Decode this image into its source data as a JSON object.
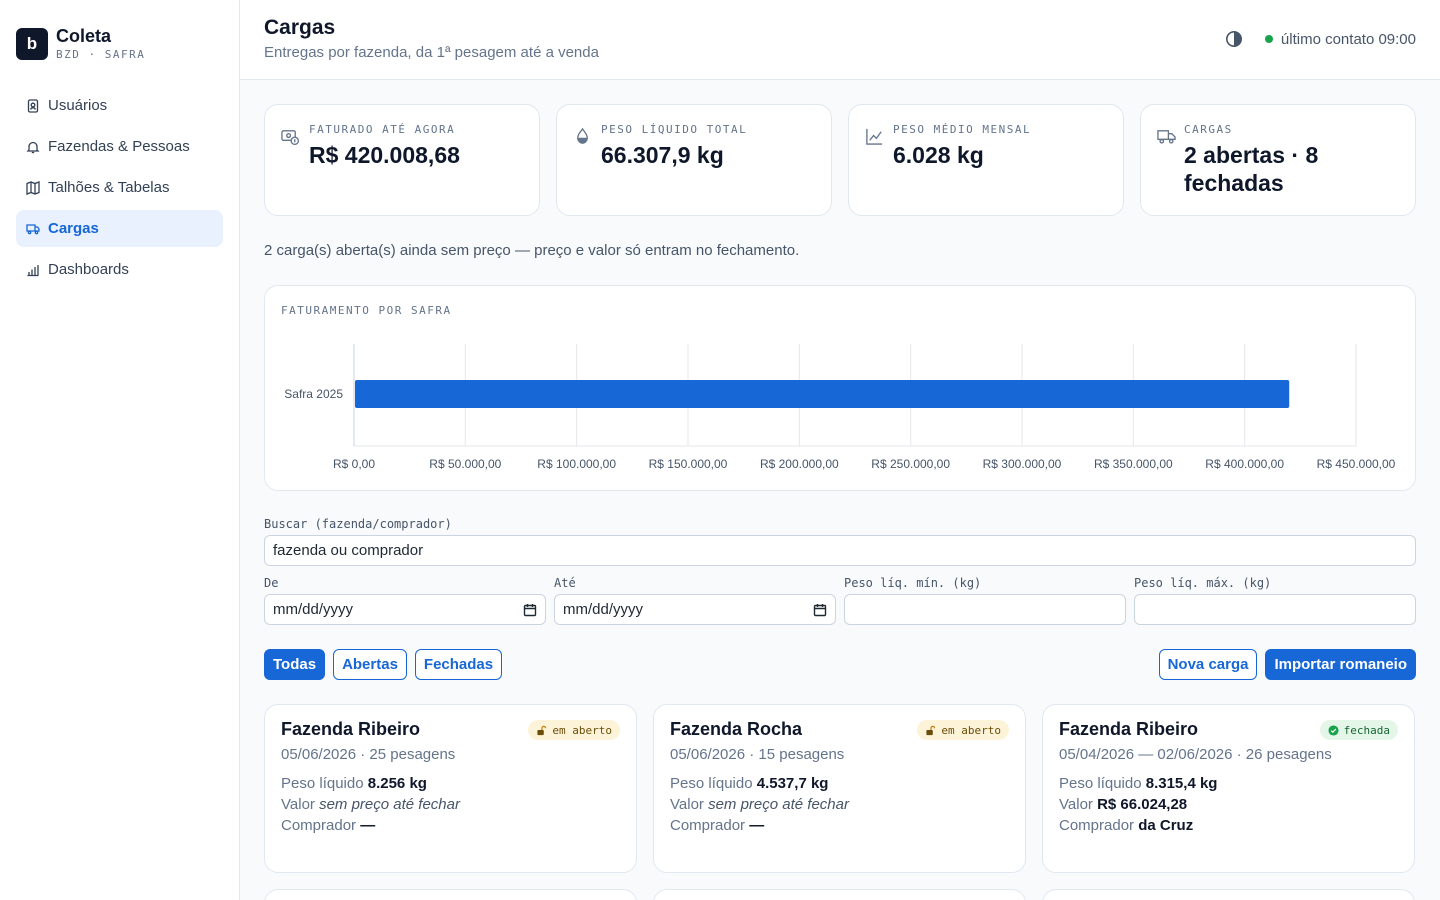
{
  "brand": {
    "logo_letter": "b",
    "name": "Coleta",
    "subtitle": "BZD · SAFRA"
  },
  "sidebar": {
    "items": [
      {
        "label": "Usuários",
        "icon": "id-badge-icon",
        "active": false
      },
      {
        "label": "Fazendas & Pessoas",
        "icon": "bell-icon",
        "active": false
      },
      {
        "label": "Talhões & Tabelas",
        "icon": "map-icon",
        "active": false
      },
      {
        "label": "Cargas",
        "icon": "truck-icon",
        "active": true
      },
      {
        "label": "Dashboards",
        "icon": "bar-chart-icon",
        "active": false
      }
    ]
  },
  "header": {
    "title": "Cargas",
    "subtitle": "Entregas por fazenda, da 1ª pesagem até a venda",
    "status": "último contato 09:00",
    "status_color": "#16a34a"
  },
  "kpis": [
    {
      "label": "FATURADO ATÉ AGORA",
      "value": "R$ 420.008,68",
      "icon": "money-icon"
    },
    {
      "label": "PESO LÍQUIDO TOTAL",
      "value": "66.307,9 kg",
      "icon": "droplet-icon"
    },
    {
      "label": "PESO MÉDIO MENSAL",
      "value": "6.028 kg",
      "icon": "trend-icon"
    },
    {
      "label": "CARGAS",
      "value": "2 abertas · 8 fechadas",
      "icon": "truck-icon"
    }
  ],
  "notice": "2 carga(s) aberta(s) ainda sem preço — preço e valor só entram no fechamento.",
  "chart_data": {
    "type": "bar",
    "orientation": "horizontal",
    "title": "FATURAMENTO POR SAFRA",
    "categories": [
      "Safra 2025"
    ],
    "values": [
      420008.68
    ],
    "xlim": [
      0,
      450000
    ],
    "xticks": [
      0,
      50000,
      100000,
      150000,
      200000,
      250000,
      300000,
      350000,
      400000,
      450000
    ],
    "xtick_labels": [
      "R$ 0,00",
      "R$ 50.000,00",
      "R$ 100.000,00",
      "R$ 150.000,00",
      "R$ 200.000,00",
      "R$ 250.000,00",
      "R$ 300.000,00",
      "R$ 350.000,00",
      "R$ 400.000,00",
      "R$ 450.000,00"
    ],
    "grid": true,
    "bar_color": "#1767d6"
  },
  "filters": {
    "search": {
      "label": "Buscar (fazenda/comprador)",
      "placeholder": "fazenda ou comprador"
    },
    "from": {
      "label": "De",
      "value": "mm/dd/yyyy"
    },
    "to": {
      "label": "Até",
      "value": "mm/dd/yyyy"
    },
    "min": {
      "label": "Peso líq. mín. (kg)",
      "value": ""
    },
    "max": {
      "label": "Peso líq. máx. (kg)",
      "value": ""
    }
  },
  "tabs": {
    "all": "Todas",
    "open": "Abertas",
    "closed": "Fechadas"
  },
  "buttons": {
    "new": "Nova carga",
    "import": "Importar romaneio"
  },
  "loads": [
    {
      "farm": "Fazenda Ribeiro",
      "meta": "05/06/2026 · 25 pesagens",
      "status": "em aberto",
      "status_type": "open",
      "weight_label": "Peso líquido",
      "weight": "8.256 kg",
      "value_label": "Valor",
      "value": "sem preço até fechar",
      "value_italic": true,
      "buyer_label": "Comprador",
      "buyer": "—"
    },
    {
      "farm": "Fazenda Rocha",
      "meta": "05/06/2026 · 15 pesagens",
      "status": "em aberto",
      "status_type": "open",
      "weight_label": "Peso líquido",
      "weight": "4.537,7 kg",
      "value_label": "Valor",
      "value": "sem preço até fechar",
      "value_italic": true,
      "buyer_label": "Comprador",
      "buyer": "—"
    },
    {
      "farm": "Fazenda Ribeiro",
      "meta": "05/04/2026 — 02/06/2026 · 26 pesagens",
      "status": "fechada",
      "status_type": "closed",
      "weight_label": "Peso líquido",
      "weight": "8.315,4 kg",
      "value_label": "Valor",
      "value": "R$ 66.024,28",
      "value_italic": false,
      "buyer_label": "Comprador",
      "buyer": "da Cruz"
    }
  ]
}
